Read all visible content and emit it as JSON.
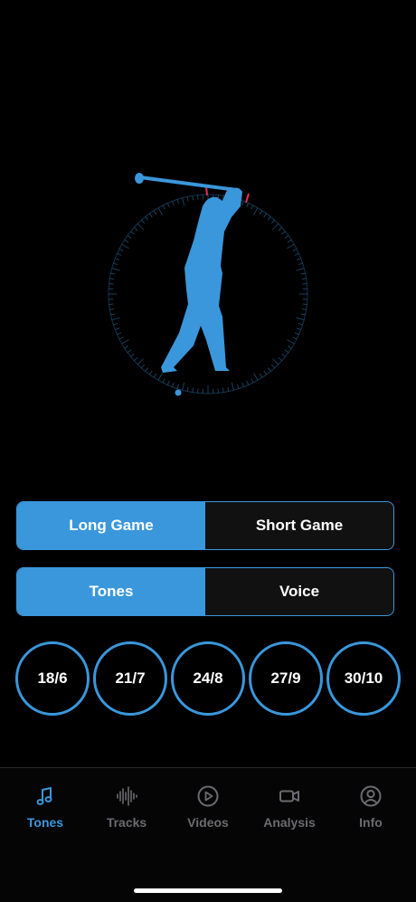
{
  "colors": {
    "accent": "#3a97db",
    "background": "#000000",
    "segment_inactive": "#111112",
    "tab_inactive": "#6b6b70",
    "tick_marker": "#e0325a"
  },
  "game_selector": {
    "options": [
      "Long Game",
      "Short Game"
    ],
    "selected": "Long Game"
  },
  "mode_selector": {
    "options": [
      "Tones",
      "Voice"
    ],
    "selected": "Tones"
  },
  "ratios": [
    "18/6",
    "21/7",
    "24/8",
    "27/9",
    "30/10"
  ],
  "tabbar": {
    "tabs": [
      {
        "label": "Tones",
        "icon": "music-note-icon",
        "active": true
      },
      {
        "label": "Tracks",
        "icon": "waveform-icon",
        "active": false
      },
      {
        "label": "Videos",
        "icon": "play-circle-icon",
        "active": false
      },
      {
        "label": "Analysis",
        "icon": "video-camera-icon",
        "active": false
      },
      {
        "label": "Info",
        "icon": "person-circle-icon",
        "active": false
      }
    ]
  }
}
